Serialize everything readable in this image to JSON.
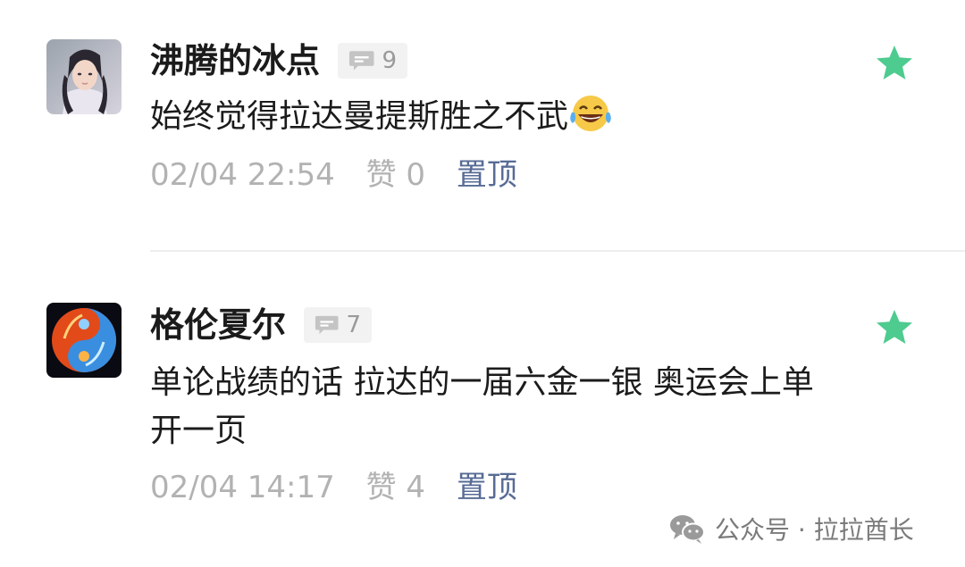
{
  "colors": {
    "text_primary": "#1b1b1b",
    "text_secondary": "#b2b2b2",
    "link": "#576b95",
    "star": "#4ecb8f",
    "badge_bg": "#f2f2f2"
  },
  "comments": [
    {
      "username": "沸腾的冰点",
      "reply_count": "9",
      "content": "始终觉得拉达曼提斯胜之不武",
      "content_emoji": "laughing-tears-emoji",
      "timestamp": "02/04 22:54",
      "likes": "赞 0",
      "pin_label": "置顶",
      "starred": true,
      "avatar_icon": "male-character-avatar"
    },
    {
      "username": "格伦夏尔",
      "reply_count": "7",
      "content": "单论战绩的话 拉达的一届六金一银 奥运会上单开一页",
      "timestamp": "02/04 14:17",
      "likes": "赞 4",
      "pin_label": "置顶",
      "starred": true,
      "avatar_icon": "fire-ice-yinyang-avatar"
    }
  ],
  "watermark": {
    "text": "公众号 · 拉拉酋长",
    "icon": "wechat-icon"
  }
}
